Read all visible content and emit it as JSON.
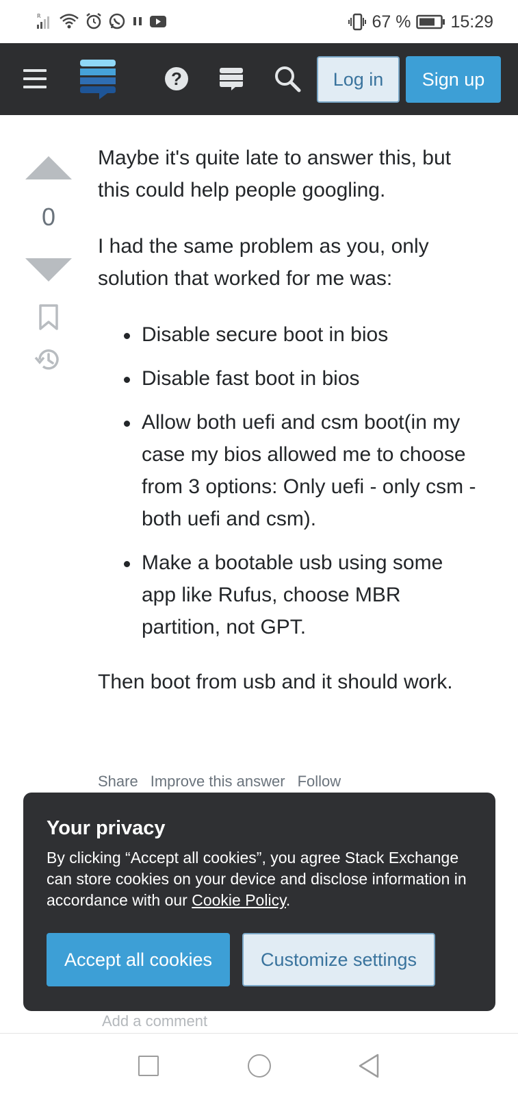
{
  "status_bar": {
    "battery": "67 %",
    "time": "15:29"
  },
  "nav": {
    "login_label": "Log in",
    "signup_label": "Sign up"
  },
  "vote": {
    "count": "0"
  },
  "answer": {
    "paragraphs_top": [
      "Maybe it's quite late to answer this, but this could help people googling.",
      "I had the same problem as you, only solution that worked for me was:"
    ],
    "bullets": [
      "Disable secure boot in bios",
      "Disable fast boot in bios",
      "Allow both uefi and csm boot(in my case my bios allowed me to choose from 3 options: Only uefi - only csm - both uefi and csm).",
      "Make a bootable usb using some app like Rufus, choose MBR partition, not GPT."
    ],
    "paragraph_bottom": "Then boot from usb and it should work."
  },
  "post_menu": {
    "share": "Share",
    "improve": "Improve this answer",
    "follow": "Follow"
  },
  "comments": {
    "add_comment": "Add a comment"
  },
  "cookie_banner": {
    "title": "Your privacy",
    "message_before": "By clicking “Accept all cookies”, you agree Stack Exchange can store cookies on your device and disclose information in accordance with our ",
    "policy_link": "Cookie Policy",
    "message_after": ".",
    "accept_label": "Accept all cookies",
    "customize_label": "Customize settings"
  },
  "colors": {
    "topbar_bg": "#2d2e30",
    "primary_button": "#3d9fd6",
    "secondary_button_bg": "#e1ecf4",
    "secondary_button_text": "#39739d",
    "cookie_bg": "#2f3033"
  },
  "icons": [
    "menu-icon",
    "stack-exchange-logo",
    "help-icon",
    "inbox-icon",
    "search-icon",
    "vote-up-icon",
    "vote-down-icon",
    "bookmark-icon",
    "history-icon"
  ]
}
